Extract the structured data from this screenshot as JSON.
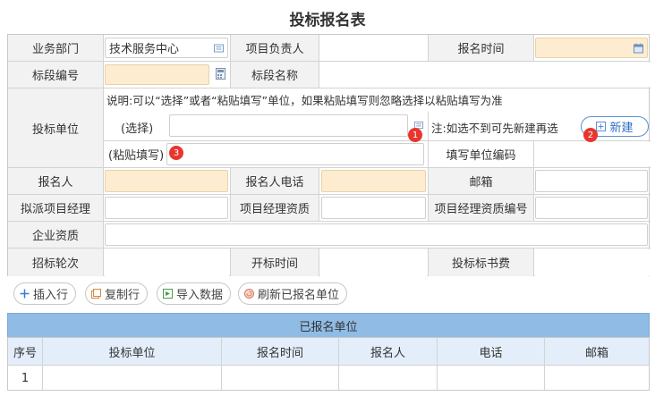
{
  "page": {
    "title": "投标报名表"
  },
  "form": {
    "dept_label": "业务部门",
    "dept_value": "技术服务中心",
    "pm_label": "项目负责人",
    "pm_value": "",
    "signup_time_label": "报名时间",
    "signup_time_value": "",
    "section_no_label": "标段编号",
    "section_no_value": "",
    "section_name_label": "标段名称",
    "section_name_value": "",
    "bidder_label": "投标单位",
    "bidder_note": "说明:可以“选择”或者“粘贴填写”单位，如果粘贴填写则忽略选择以粘贴填写为准",
    "select_label": "(选择)",
    "select_value": "",
    "select_hint": "注:如选不到可先新建再选",
    "new_button": "新建",
    "paste_label": "(粘贴填写)",
    "paste_value": "",
    "unit_code_label": "填写单位编码",
    "unit_code_value": "",
    "applicant_label": "报名人",
    "applicant_value": "",
    "applicant_phone_label": "报名人电话",
    "applicant_phone_value": "",
    "email_label": "邮箱",
    "email_value": "",
    "pm_assign_label": "拟派项目经理",
    "pm_assign_value": "",
    "pm_qual_label": "项目经理资质",
    "pm_qual_value": "",
    "pm_qual_no_label": "项目经理资质编号",
    "pm_qual_no_value": "",
    "company_qual_label": "企业资质",
    "company_qual_value": "",
    "round_label": "招标轮次",
    "round_value": "",
    "open_time_label": "开标时间",
    "open_time_value": "",
    "fee_label": "投标标书费",
    "fee_value": ""
  },
  "badges": {
    "b1": "1",
    "b2": "2",
    "b3": "3"
  },
  "toolbar": {
    "insert_row": "插入行",
    "copy_row": "复制行",
    "import_data": "导入数据",
    "refresh_units": "刷新已报名单位"
  },
  "registered": {
    "title": "已报名单位",
    "columns": [
      "序号",
      "投标单位",
      "报名时间",
      "报名人",
      "电话",
      "邮箱"
    ],
    "rows": [
      [
        "1",
        "",
        "",
        "",
        "",
        ""
      ]
    ]
  },
  "colors": {
    "required_bg": "#fdecd0",
    "header_blue": "#8fbbe4",
    "accent": "#2f6fc4",
    "badge_red": "#e8362e"
  },
  "icons": [
    "list-picker-icon",
    "calendar-icon",
    "calculator-icon",
    "plus-icon",
    "copy-icon",
    "import-icon",
    "refresh-icon"
  ]
}
